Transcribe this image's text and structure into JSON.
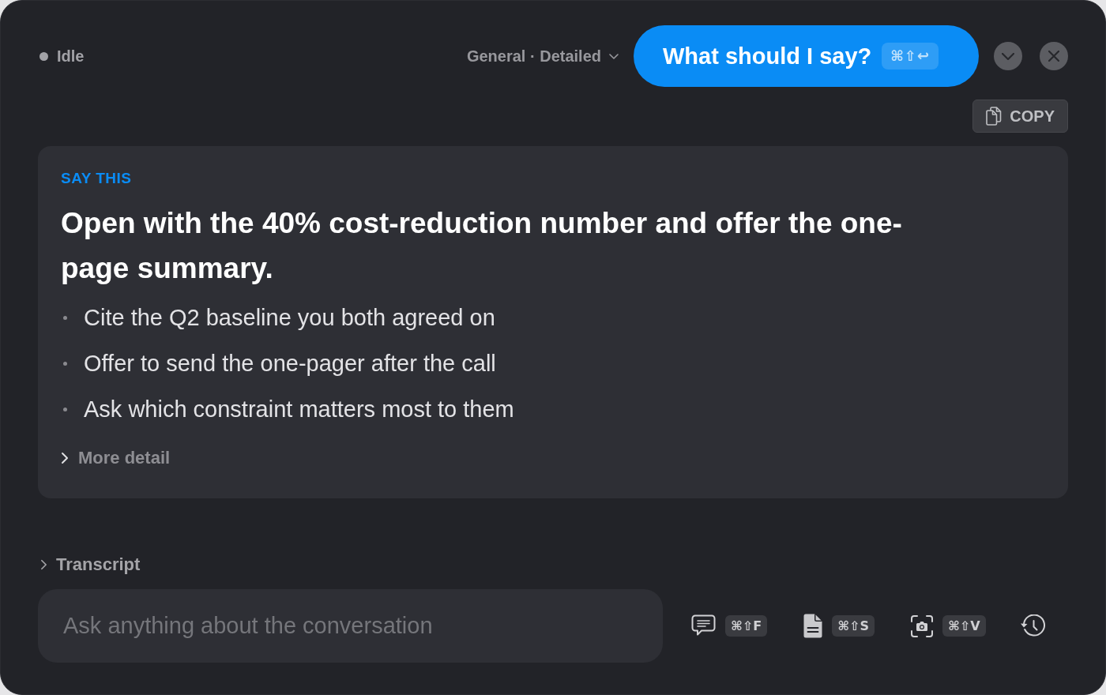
{
  "status": {
    "label": "Idle"
  },
  "mode_selector": {
    "label": "General · Detailed"
  },
  "ask_button": {
    "label": "What should I say?",
    "shortcut": "⌘⇧↩"
  },
  "copy_button": {
    "label": "COPY"
  },
  "suggestion": {
    "heading": "SAY THIS",
    "text": "Open with the 40% cost-reduction number and offer the one-page summary.",
    "bullets": [
      "Cite the Q2 baseline you both agreed on",
      "Offer to send the one-pager after the call",
      "Ask which constraint matters most to them"
    ],
    "more_detail": {
      "label": "More detail",
      "expanded": false
    }
  },
  "transcript": {
    "label": "Transcript",
    "expanded": false
  },
  "input": {
    "placeholder": "Ask anything about the conversation"
  },
  "tools": [
    {
      "kind": "chat",
      "shortcut": "⌘⇧F"
    },
    {
      "kind": "document",
      "shortcut": "⌘⇧S"
    },
    {
      "kind": "screenshot",
      "shortcut": "⌘⇧V"
    },
    {
      "kind": "history"
    }
  ]
}
